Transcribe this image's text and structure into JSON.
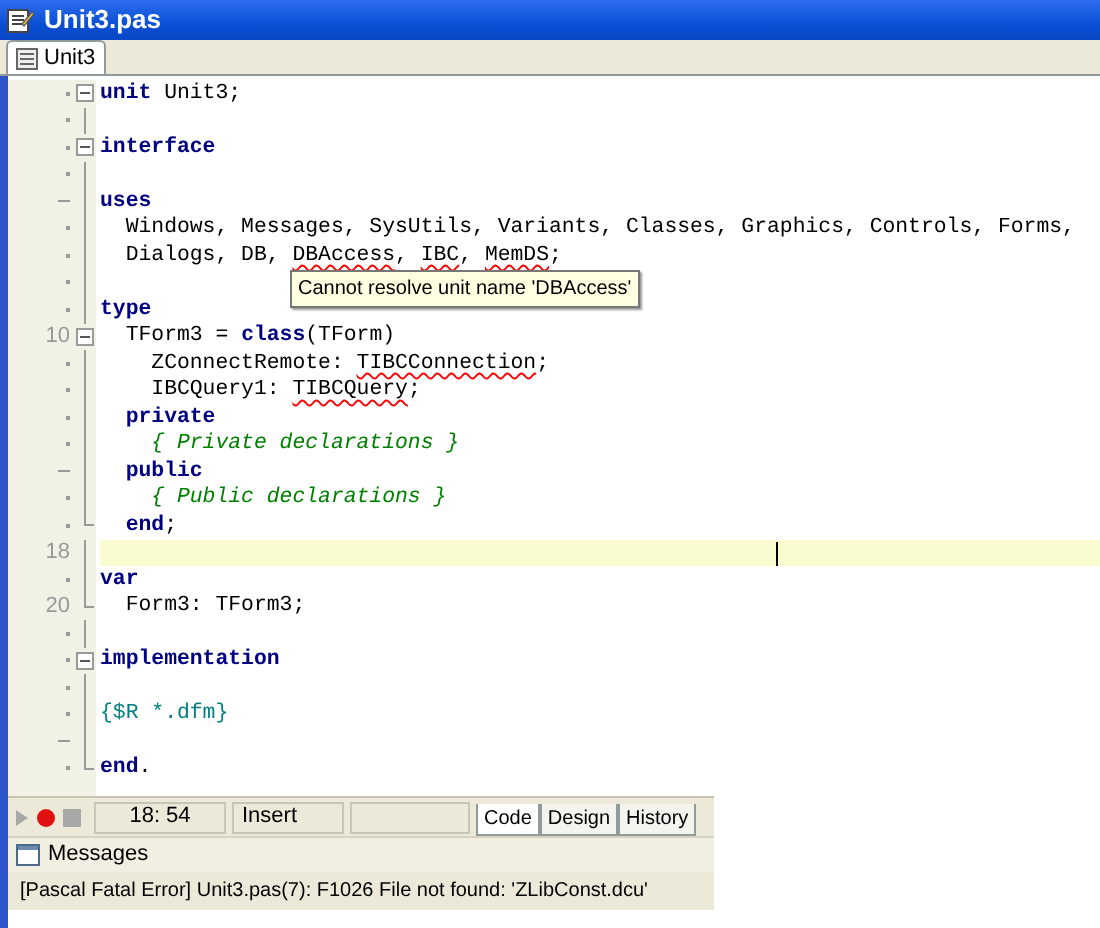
{
  "window": {
    "title": "Unit3.pas"
  },
  "tabs": [
    {
      "label": "Unit3",
      "selected": true
    }
  ],
  "editor": {
    "lines": [
      {
        "gutter": {
          "kind": "dot"
        },
        "fold_marker": {
          "kind": "open"
        },
        "selected": false,
        "tokens": [
          {
            "text": "unit",
            "kind": "keyword"
          },
          {
            "text": " Unit3;",
            "kind": "plain"
          }
        ]
      },
      {
        "gutter": {
          "kind": "dot"
        },
        "fold_marker": {
          "kind": "line"
        },
        "selected": false
      },
      {
        "gutter": {
          "kind": "dot"
        },
        "fold_marker": {
          "kind": "open"
        },
        "selected": false,
        "tokens": [
          {
            "text": "interface",
            "kind": "keyword"
          }
        ]
      },
      {
        "gutter": {
          "kind": "dot"
        },
        "fold_marker": {
          "kind": "line"
        },
        "selected": false
      },
      {
        "gutter": {
          "kind": "dash"
        },
        "fold_marker": {
          "kind": "line"
        },
        "selected": false,
        "tokens": [
          {
            "text": "uses",
            "kind": "keyword"
          }
        ]
      },
      {
        "gutter": {
          "kind": "dot"
        },
        "fold_marker": {
          "kind": "line"
        },
        "selected": false,
        "tokens": [
          {
            "text": "  Windows, Messages, SysUtils, Variants, Classes, Graphics, Controls, Forms,",
            "kind": "plain"
          }
        ]
      },
      {
        "gutter": {
          "kind": "dot"
        },
        "fold_marker": {
          "kind": "line"
        },
        "selected": false,
        "tokens": [
          {
            "text": "  Dialogs, DB, ",
            "kind": "plain"
          },
          {
            "text": "DBAccess",
            "kind": "unresolved"
          },
          {
            "text": ", ",
            "kind": "plain"
          },
          {
            "text": "IBC",
            "kind": "unresolved"
          },
          {
            "text": ", ",
            "kind": "plain"
          },
          {
            "text": "MemDS",
            "kind": "unresolved"
          },
          {
            "text": ";",
            "kind": "plain"
          }
        ]
      },
      {
        "gutter": {
          "kind": "dot"
        },
        "fold_marker": {
          "kind": "line"
        },
        "selected": false
      },
      {
        "gutter": {
          "kind": "dot"
        },
        "fold_marker": {
          "kind": "line"
        },
        "selected": false,
        "tokens": [
          {
            "text": "type",
            "kind": "keyword"
          }
        ]
      },
      {
        "gutter": {
          "kind": "number",
          "text": "10"
        },
        "fold_marker": {
          "kind": "open"
        },
        "selected": false,
        "tokens": [
          {
            "text": "  TForm3 = ",
            "kind": "plain"
          },
          {
            "text": "class",
            "kind": "keyword"
          },
          {
            "text": "(TForm)",
            "kind": "plain"
          }
        ]
      },
      {
        "gutter": {
          "kind": "dot"
        },
        "fold_marker": {
          "kind": "line"
        },
        "selected": false,
        "tokens": [
          {
            "text": "    ZConnectRemote: ",
            "kind": "plain"
          },
          {
            "text": "TIBCConnection",
            "kind": "unresolved"
          },
          {
            "text": ";",
            "kind": "plain"
          }
        ]
      },
      {
        "gutter": {
          "kind": "dot"
        },
        "fold_marker": {
          "kind": "line"
        },
        "selected": false,
        "tokens": [
          {
            "text": "    IBCQuery1: ",
            "kind": "plain"
          },
          {
            "text": "TIBCQuery",
            "kind": "unresolved"
          },
          {
            "text": ";",
            "kind": "plain"
          }
        ]
      },
      {
        "gutter": {
          "kind": "dot"
        },
        "fold_marker": {
          "kind": "line"
        },
        "selected": false,
        "tokens": [
          {
            "text": "  private",
            "kind": "keyword"
          }
        ]
      },
      {
        "gutter": {
          "kind": "dot"
        },
        "fold_marker": {
          "kind": "line"
        },
        "selected": false,
        "tokens": [
          {
            "text": "    { Private declarations }",
            "kind": "comment"
          }
        ]
      },
      {
        "gutter": {
          "kind": "dash"
        },
        "fold_marker": {
          "kind": "line"
        },
        "selected": false,
        "tokens": [
          {
            "text": "  public",
            "kind": "keyword"
          }
        ]
      },
      {
        "gutter": {
          "kind": "dot"
        },
        "fold_marker": {
          "kind": "line"
        },
        "selected": false,
        "tokens": [
          {
            "text": "    { Public declarations }",
            "kind": "comment"
          }
        ]
      },
      {
        "gutter": {
          "kind": "dot"
        },
        "fold_marker": {
          "kind": "end"
        },
        "selected": false,
        "tokens": [
          {
            "text": "  end",
            "kind": "keyword"
          },
          {
            "text": ";",
            "kind": "plain"
          }
        ]
      },
      {
        "gutter": {
          "kind": "number",
          "text": "18"
        },
        "fold_marker": {
          "kind": "line"
        },
        "selected": true
      },
      {
        "gutter": {
          "kind": "dot"
        },
        "fold_marker": {
          "kind": "line"
        },
        "selected": false,
        "tokens": [
          {
            "text": "var",
            "kind": "keyword"
          }
        ]
      },
      {
        "gutter": {
          "kind": "number",
          "text": "20"
        },
        "fold_marker": {
          "kind": "end"
        },
        "selected": false,
        "tokens": [
          {
            "text": "  Form3: TForm3;",
            "kind": "plain"
          }
        ]
      },
      {
        "gutter": {
          "kind": "dot"
        },
        "fold_marker": {
          "kind": "line"
        },
        "selected": false
      },
      {
        "gutter": {
          "kind": "dot"
        },
        "fold_marker": {
          "kind": "open"
        },
        "selected": false,
        "tokens": [
          {
            "text": "implementation",
            "kind": "keyword"
          }
        ]
      },
      {
        "gutter": {
          "kind": "dot"
        },
        "fold_marker": {
          "kind": "line"
        },
        "selected": false
      },
      {
        "gutter": {
          "kind": "dot"
        },
        "fold_marker": {
          "kind": "line"
        },
        "selected": false,
        "tokens": [
          {
            "text": "{$R *.dfm}",
            "kind": "directive"
          }
        ]
      },
      {
        "gutter": {
          "kind": "dash"
        },
        "fold_marker": {
          "kind": "line"
        },
        "selected": false
      },
      {
        "gutter": {
          "kind": "dot"
        },
        "fold_marker": {
          "kind": "end"
        },
        "selected": false,
        "tokens": [
          {
            "text": "end",
            "kind": "keyword"
          },
          {
            "text": ".",
            "kind": "plain"
          }
        ]
      }
    ],
    "tooltip": "Cannot resolve unit name 'DBAccess'"
  },
  "status_bar": {
    "position": "18: 54",
    "mode": "Insert",
    "view_tabs": [
      {
        "label": "Code",
        "selected": true
      },
      {
        "label": "Design",
        "selected": false
      },
      {
        "label": "History",
        "selected": false
      }
    ]
  },
  "messages": {
    "title": "Messages",
    "items": [
      "[Pascal Fatal Error] Unit3.pas(7): F1026 File not found: 'ZLibConst.dcu'"
    ]
  }
}
